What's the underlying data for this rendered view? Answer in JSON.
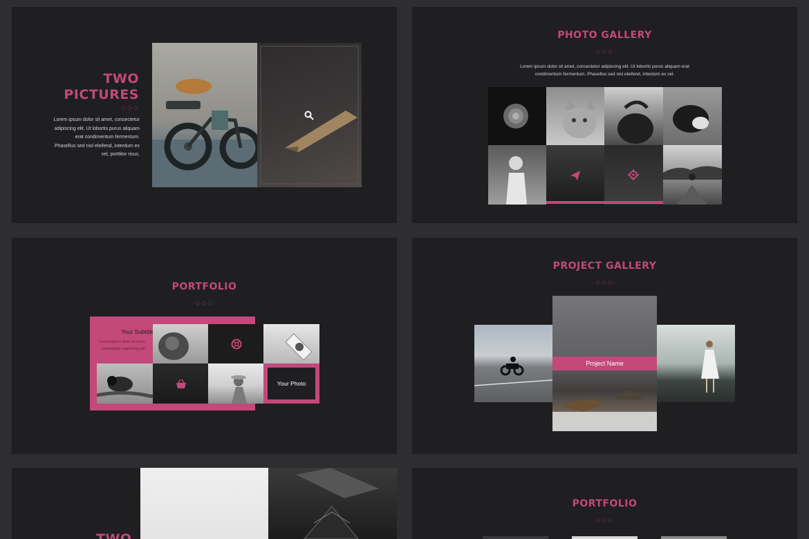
{
  "slides": {
    "two_pictures": {
      "title_line1": "TWO",
      "title_line2": "PICTURES",
      "body": "Lorem ipsum dolor sit amet, consectetur adipiscing elit. Ut lobortis purus aliquam erat condimentum fermentum. Phasellus sed nisl eleifend, interdum ex vel, porttitor risus."
    },
    "photo_gallery": {
      "title": "PHOTO GALLERY",
      "body": "Lorem ipsum dolor sit amet, consectetur adipiscing elit. Ut lobortis purus aliquam erat condimentum fermentum. Phasellus sed nisl eleifend, interdum ex vel."
    },
    "portfolio": {
      "title": "PORTFOLIO",
      "subtitle": "Your Subtitle",
      "body": "Lorem ipsum dolor sit amet, consectetur adipiscing elit.",
      "photo_label": "Your Photo"
    },
    "project_gallery": {
      "title": "PROJECT GALLERY",
      "project_name": "Project Name"
    },
    "two_pictures_2": {
      "title": "TWO"
    },
    "portfolio_2": {
      "title": "PORTFOLIO"
    }
  },
  "icons": [
    "search-icon",
    "paper-plane-icon",
    "gear-icon",
    "lifebuoy-icon",
    "shopping-basket-icon"
  ],
  "colors": {
    "accent": "#c2497a",
    "slide_bg": "#1f1e21",
    "page_bg": "#2e2e31"
  }
}
